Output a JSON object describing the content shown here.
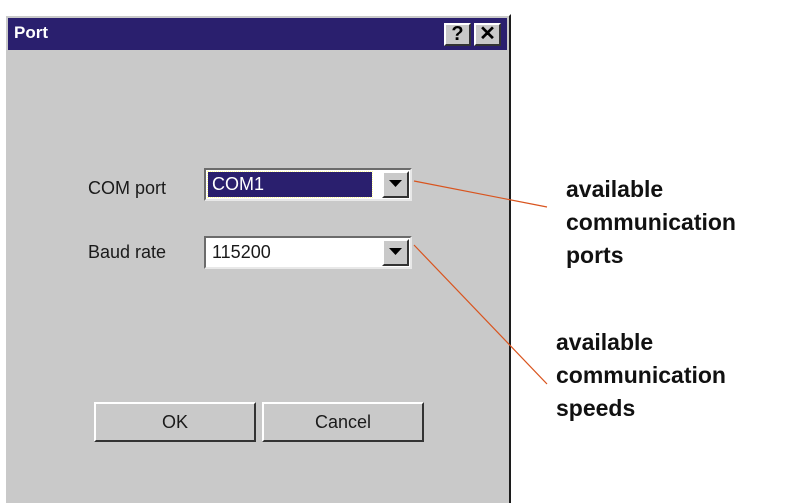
{
  "window": {
    "title": "Port",
    "help_glyph": "?",
    "close_glyph": "✕"
  },
  "form": {
    "com_port_label": "COM port",
    "com_port_value": "COM1",
    "baud_rate_label": "Baud rate",
    "baud_rate_value": "115200"
  },
  "buttons": {
    "ok_label": "OK",
    "cancel_label": "Cancel"
  },
  "annotations": {
    "ports_callout": [
      "available",
      "communication",
      "ports"
    ],
    "speeds_callout": [
      "available",
      "communication",
      "speeds"
    ],
    "leader_color": "#d9541e"
  }
}
